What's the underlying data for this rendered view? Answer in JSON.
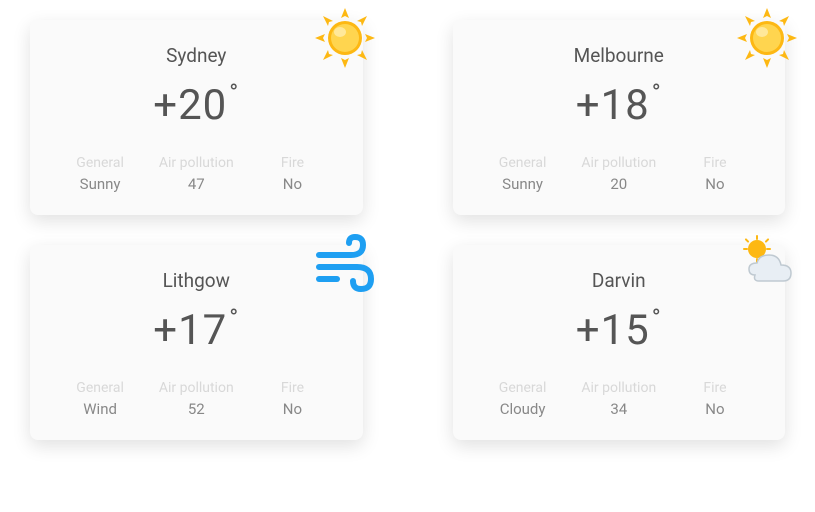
{
  "labels": {
    "general": "General",
    "air_pollution": "Air pollution",
    "fire": "Fire"
  },
  "cards": [
    {
      "city": "Sydney",
      "temp": "+20",
      "icon": "sun",
      "general": "Sunny",
      "air": "47",
      "fire": "No"
    },
    {
      "city": "Melbourne",
      "temp": "+18",
      "icon": "sun",
      "general": "Sunny",
      "air": "20",
      "fire": "No"
    },
    {
      "city": "Lithgow",
      "temp": "+17",
      "icon": "wind",
      "general": "Wind",
      "air": "52",
      "fire": "No"
    },
    {
      "city": "Darvin",
      "temp": "+15",
      "icon": "partly-cloudy",
      "general": "Cloudy",
      "air": "34",
      "fire": "No"
    }
  ]
}
